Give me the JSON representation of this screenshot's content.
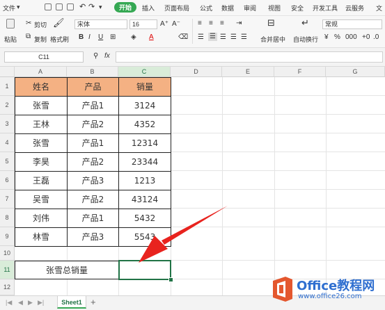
{
  "menu": {
    "file": "文件",
    "tabs": [
      "开始",
      "插入",
      "页面布局",
      "公式",
      "数据",
      "审阅",
      "视图",
      "安全",
      "开发工具",
      "云服务",
      "文"
    ],
    "active_tab": "开始"
  },
  "ribbon": {
    "cut": "剪切",
    "copy": "复制",
    "paste": "粘贴",
    "format_painter": "格式刷",
    "font_name": "宋体",
    "font_size": "16",
    "merge_center": "合并居中",
    "wrap_text": "自动换行",
    "number_format": "常规",
    "bold": "B",
    "italic": "I",
    "underline": "U"
  },
  "formula_bar": {
    "cell_ref": "C11",
    "fx": "fx",
    "value": ""
  },
  "sheet": {
    "columns": [
      "A",
      "B",
      "C",
      "D",
      "E",
      "F",
      "G"
    ],
    "rows": [
      "1",
      "2",
      "3",
      "4",
      "5",
      "6",
      "7",
      "8",
      "9",
      "10",
      "11",
      "12"
    ],
    "header": [
      "姓名",
      "产品",
      "销量"
    ],
    "data": [
      [
        "张雪",
        "产品1",
        "3124"
      ],
      [
        "王林",
        "产品2",
        "4352"
      ],
      [
        "张雪",
        "产品1",
        "12314"
      ],
      [
        "李昊",
        "产品2",
        "23344"
      ],
      [
        "王磊",
        "产品3",
        "1213"
      ],
      [
        "吴雪",
        "产品2",
        "43124"
      ],
      [
        "刘伟",
        "产品1",
        "5432"
      ],
      [
        "林雪",
        "产品3",
        "5543"
      ]
    ],
    "summary_label": "张雪总销量",
    "summary_value": ""
  },
  "tabs": {
    "sheet1": "Sheet1",
    "add": "+"
  },
  "watermark": {
    "brand": "Office教程网",
    "url": "www.office26.com"
  },
  "colors": {
    "header_fill": "#f4b183",
    "selection": "#217346",
    "arrow": "#e8231e",
    "accent": "#35a853"
  }
}
